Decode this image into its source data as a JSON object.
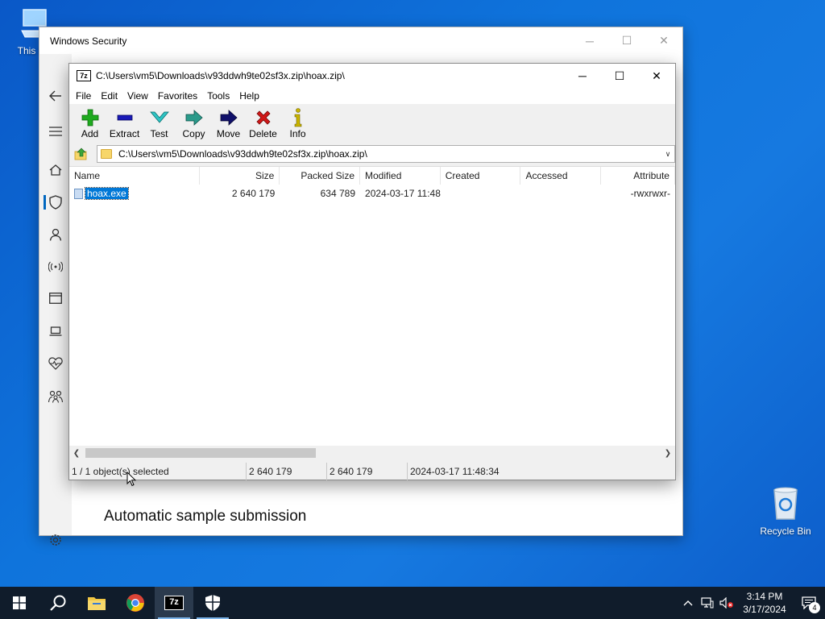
{
  "desktop": {
    "this_pc_label": "This PC",
    "recycle_bin_label": "Recycle Bin"
  },
  "windows_security": {
    "title": "Windows Security",
    "bottom_text": "Automatic sample submission",
    "nav_icons": [
      "back-arrow-icon",
      "hamburger-icon",
      "home-icon",
      "shield-icon",
      "person-icon",
      "antenna-icon",
      "app-window-icon",
      "laptop-icon",
      "heart-pulse-icon",
      "family-icon",
      "gear-icon"
    ]
  },
  "zip": {
    "title": "C:\\Users\\vm5\\Downloads\\v93ddwh9te02sf3x.zip\\hoax.zip\\",
    "logo": "7z",
    "menu": [
      "File",
      "Edit",
      "View",
      "Favorites",
      "Tools",
      "Help"
    ],
    "toolbar": [
      {
        "label": "Add",
        "icon": "plus-icon",
        "color": "#1eaa1e"
      },
      {
        "label": "Extract",
        "icon": "minus-icon",
        "color": "#1a1ab8"
      },
      {
        "label": "Test",
        "icon": "check-chevron-icon",
        "color": "#2ec4c4"
      },
      {
        "label": "Copy",
        "icon": "copy-arrow-icon",
        "color": "#2a9a8a"
      },
      {
        "label": "Move",
        "icon": "move-arrow-icon",
        "color": "#10106a"
      },
      {
        "label": "Delete",
        "icon": "x-icon",
        "color": "#d01818"
      },
      {
        "label": "Info",
        "icon": "info-icon",
        "color": "#c9b400"
      }
    ],
    "address": "C:\\Users\\vm5\\Downloads\\v93ddwh9te02sf3x.zip\\hoax.zip\\",
    "columns": [
      "Name",
      "Size",
      "Packed Size",
      "Modified",
      "Created",
      "Accessed",
      "Attribute"
    ],
    "rows": [
      {
        "name": "hoax.exe",
        "size": "2 640 179",
        "packed": "634 789",
        "modified": "2024-03-17 11:48",
        "created": "",
        "accessed": "",
        "attributes": "-rwxrwxr-"
      }
    ],
    "status": {
      "selection": "1 / 1 object(s) selected",
      "size": "2 640 179",
      "packed": "2 640 179",
      "modified": "2024-03-17 11:48:34"
    }
  },
  "taskbar": {
    "apps": [
      "windows-start-icon",
      "search-icon",
      "file-explorer-icon",
      "chrome-icon",
      "7zip-icon",
      "windows-security-icon"
    ],
    "seven_zip_label": "7z",
    "time": "3:14 PM",
    "date": "3/17/2024",
    "notification_count": "4"
  }
}
